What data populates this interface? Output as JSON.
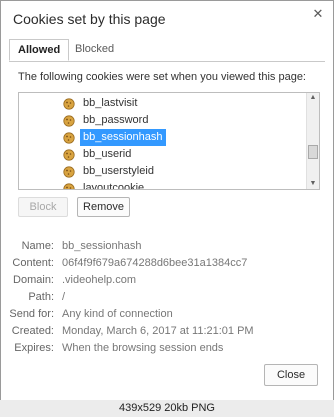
{
  "dialog": {
    "title": "Cookies set by this page",
    "close_icon": "close-icon"
  },
  "tabs": [
    {
      "label": "Allowed",
      "active": true
    },
    {
      "label": "Blocked",
      "active": false
    }
  ],
  "intro_text": "The following cookies were set when you viewed this page:",
  "cookies": [
    {
      "name": "bb_lastvisit",
      "icon": "cookie-icon",
      "selected": false
    },
    {
      "name": "bb_password",
      "icon": "cookie-icon",
      "selected": false
    },
    {
      "name": "bb_sessionhash",
      "icon": "cookie-icon",
      "selected": true
    },
    {
      "name": "bb_userid",
      "icon": "cookie-icon",
      "selected": false
    },
    {
      "name": "bb_userstyleid",
      "icon": "cookie-icon",
      "selected": false
    },
    {
      "name": "layoutcookie",
      "icon": "cookie-icon",
      "selected": false
    }
  ],
  "buttons": {
    "block": "Block",
    "remove": "Remove",
    "close": "Close"
  },
  "details": {
    "name": {
      "label": "Name:",
      "value": "bb_sessionhash"
    },
    "content": {
      "label": "Content:",
      "value": "06f4f9f679a674288d6bee31a1384cc7"
    },
    "domain": {
      "label": "Domain:",
      "value": ".videohelp.com"
    },
    "path": {
      "label": "Path:",
      "value": "/"
    },
    "send_for": {
      "label": "Send for:",
      "value": "Any kind of connection"
    },
    "created": {
      "label": "Created:",
      "value": "Monday, March 6, 2017 at 11:21:01 PM"
    },
    "expires": {
      "label": "Expires:",
      "value": "When the browsing session ends"
    }
  },
  "caption": "439x529  20kb  PNG",
  "colors": {
    "selection": "#3399ff",
    "cookie": "#d9a441"
  }
}
